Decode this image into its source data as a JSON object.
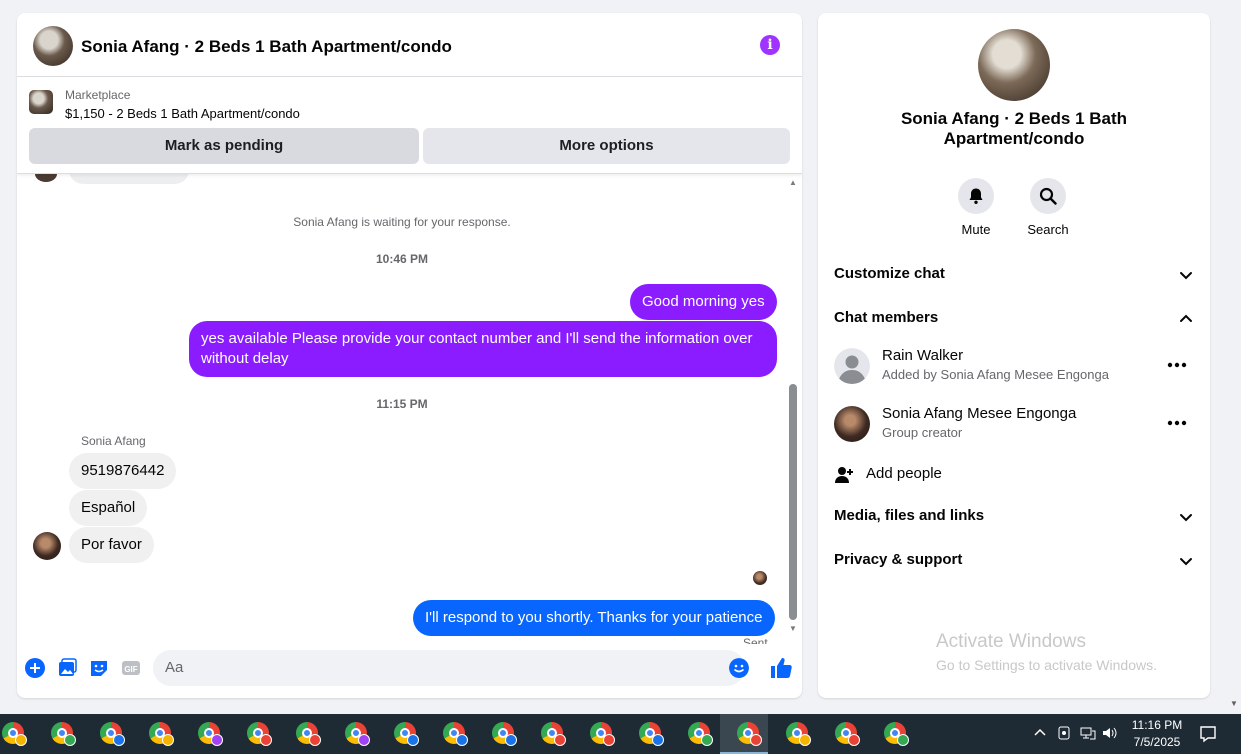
{
  "chat": {
    "title": "Sonia Afang · 2 Beds 1 Bath Apartment/condo",
    "marketplace": {
      "label": "Marketplace",
      "listing": "$1,150 - 2 Beds 1 Bath Apartment/condo",
      "pending_button": "Mark as pending",
      "more_button": "More options"
    },
    "system_message": "Sonia Afang is waiting for your response.",
    "time_1": "10:46 PM",
    "out_1": "Good morning yes",
    "out_2": "yes available Please provide your contact number and I'll send the information over without delay",
    "time_2": "11:15 PM",
    "sender": "Sonia Afang",
    "in_1": "9519876442",
    "in_2": "Español",
    "in_3": "Por favor",
    "out_3": "I'll respond to you shortly. Thanks for your patience",
    "status": "Sent",
    "composer_placeholder": "Aa"
  },
  "info": {
    "name": "Sonia Afang · 2 Beds 1 Bath Apartment/condo",
    "actions": {
      "mute": "Mute",
      "search": "Search"
    },
    "sections": {
      "customize": "Customize chat",
      "members": "Chat members",
      "media": "Media, files and links",
      "privacy": "Privacy & support"
    },
    "members": [
      {
        "name": "Rain Walker",
        "sub": "Added by Sonia Afang Mesee Engonga"
      },
      {
        "name": "Sonia Afang Mesee Engonga",
        "sub": "Group creator"
      }
    ],
    "add_people": "Add people"
  },
  "watermark": {
    "line1": "Activate Windows",
    "line2": "Go to Settings to activate Windows."
  },
  "taskbar": {
    "time": "11:16 PM",
    "date": "7/5/2025",
    "badge_colors": [
      "#f4b400",
      "#34a853",
      "#1a73e8",
      "#f4b400",
      "#a142f4",
      "#ea4335",
      "#ea4335",
      "#a142f4",
      "#1a73e8",
      "#1a73e8",
      "#1a73e8",
      "#ea4335",
      "#ea4335",
      "#1a73e8",
      "#34a853",
      "#ea4335",
      "#f4b400",
      "#ea4335",
      "#34a853"
    ]
  },
  "colors": {
    "messenger_purple": "#8a1cff",
    "messenger_blue": "#0866ff",
    "info_icon": "#a033ff"
  }
}
